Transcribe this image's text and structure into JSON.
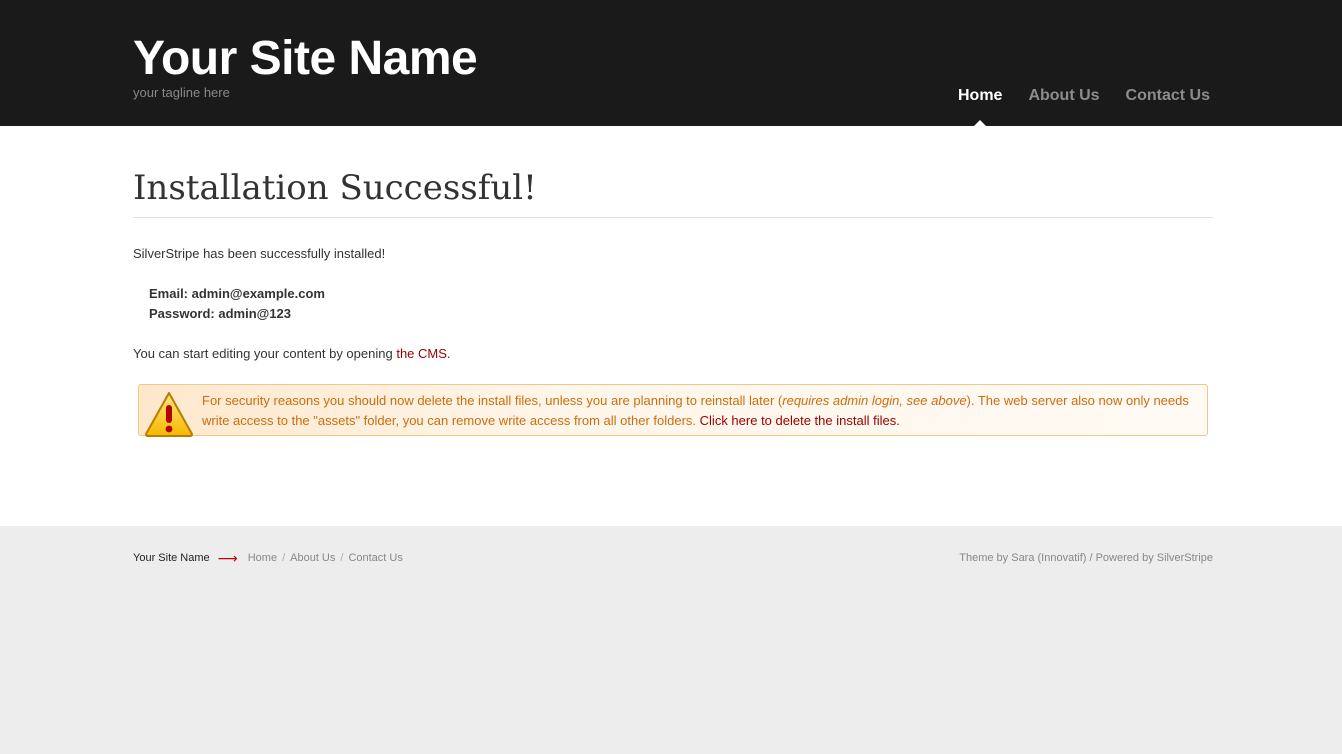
{
  "header": {
    "site_name": "Your Site Name",
    "tagline": "your tagline here",
    "nav": [
      {
        "label": "Home",
        "current": true
      },
      {
        "label": "About Us",
        "current": false
      },
      {
        "label": "Contact Us",
        "current": false
      }
    ]
  },
  "main": {
    "title": "Installation Successful!",
    "intro": "SilverStripe has been successfully installed!",
    "email_line": "Email: admin@example.com",
    "password_line": "Password: admin@123",
    "editing_prefix": "You can start editing your content by opening ",
    "cms_link": "the CMS",
    "editing_suffix": ".",
    "warning": {
      "text_1": "For security reasons you should now delete the install files, unless you are planning to reinstall later (",
      "text_em": "requires admin login, see above",
      "text_2": "). The web server also now only needs write access to the \"assets\" folder, you can remove write access from all other folders. ",
      "link": "Click here to delete the install files."
    }
  },
  "footer": {
    "site_name": "Your Site Name",
    "arrow": "⟶",
    "nav": [
      "Home",
      "About Us",
      "Contact Us"
    ],
    "separator": "/",
    "credits": "Theme by Sara (Innovatif) / Powered by SilverStripe"
  },
  "colors": {
    "header_bg": "#1a1a1a",
    "link": "#990000",
    "warning_text": "#cc6d0f",
    "footer_bg": "#ededed"
  },
  "icons": {
    "warning": "warning-triangle-icon"
  }
}
